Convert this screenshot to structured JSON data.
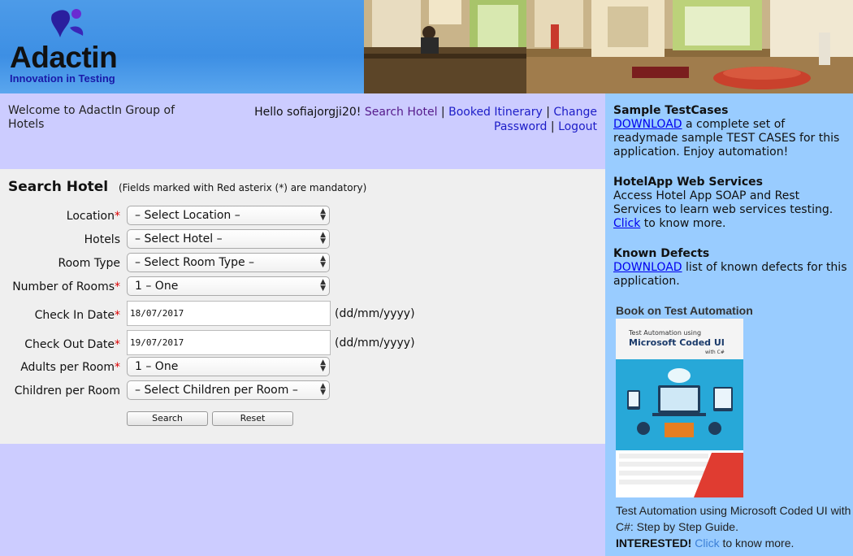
{
  "logo": {
    "name": "Adactin",
    "tagline": "Innovation in Testing"
  },
  "welcome": "Welcome to AdactIn Group of Hotels",
  "nav": {
    "greeting": "Hello sofiajorgji20!",
    "search_hotel": "Search Hotel",
    "booked_itinerary": "Booked Itinerary",
    "change_password": "Change Password",
    "logout": "Logout",
    "separator": "|"
  },
  "search": {
    "title": "Search Hotel",
    "note": "(Fields marked with Red asterix (*) are mandatory)",
    "fields": {
      "location": {
        "label": "Location",
        "value": "– Select Location –"
      },
      "hotels": {
        "label": "Hotels",
        "value": "– Select Hotel –"
      },
      "room_type": {
        "label": "Room Type",
        "value": "– Select Room Type –"
      },
      "num_rooms": {
        "label": "Number of Rooms",
        "value": "1 – One"
      },
      "check_in": {
        "label": "Check In Date",
        "value": "18/07/2017",
        "format": "(dd/mm/yyyy)"
      },
      "check_out": {
        "label": "Check Out Date",
        "value": "19/07/2017",
        "format": "(dd/mm/yyyy)"
      },
      "adults": {
        "label": "Adults per Room",
        "value": "1 – One"
      },
      "children": {
        "label": "Children per Room",
        "value": "– Select Children per Room –"
      }
    },
    "asterisk": "*",
    "search_button": "Search",
    "reset_button": "Reset"
  },
  "sidebar": {
    "testcases": {
      "title": "Sample TestCases",
      "link": "DOWNLOAD",
      "text": " a complete set of readymade sample TEST CASES for this application. Enjoy automation!"
    },
    "webservices": {
      "title": "HotelApp Web Services",
      "text": "Access Hotel App SOAP and Rest Services to learn web services testing. ",
      "link": "Click",
      "text2": " to know more."
    },
    "defects": {
      "title": "Known Defects",
      "link": "DOWNLOAD",
      "text": " list of known defects for this application."
    },
    "book": {
      "heading": "Book on Test Automation",
      "cover_line1": "Test Automation using",
      "cover_line2": "Microsoft Coded UI",
      "cover_line3": "with C#",
      "caption": "Test Automation using Microsoft Coded UI with C#: Step by Step Guide.",
      "interested": "INTERESTED!",
      "click": "Click",
      "more": " to know more."
    }
  },
  "colors": {
    "page_bg": "#ccccff",
    "panel_bg": "#efefef",
    "sidebar_bg": "#99ccff",
    "header_bg": "#3c8ee6",
    "link": "#0000ee",
    "mandatory": "#dd0000"
  }
}
